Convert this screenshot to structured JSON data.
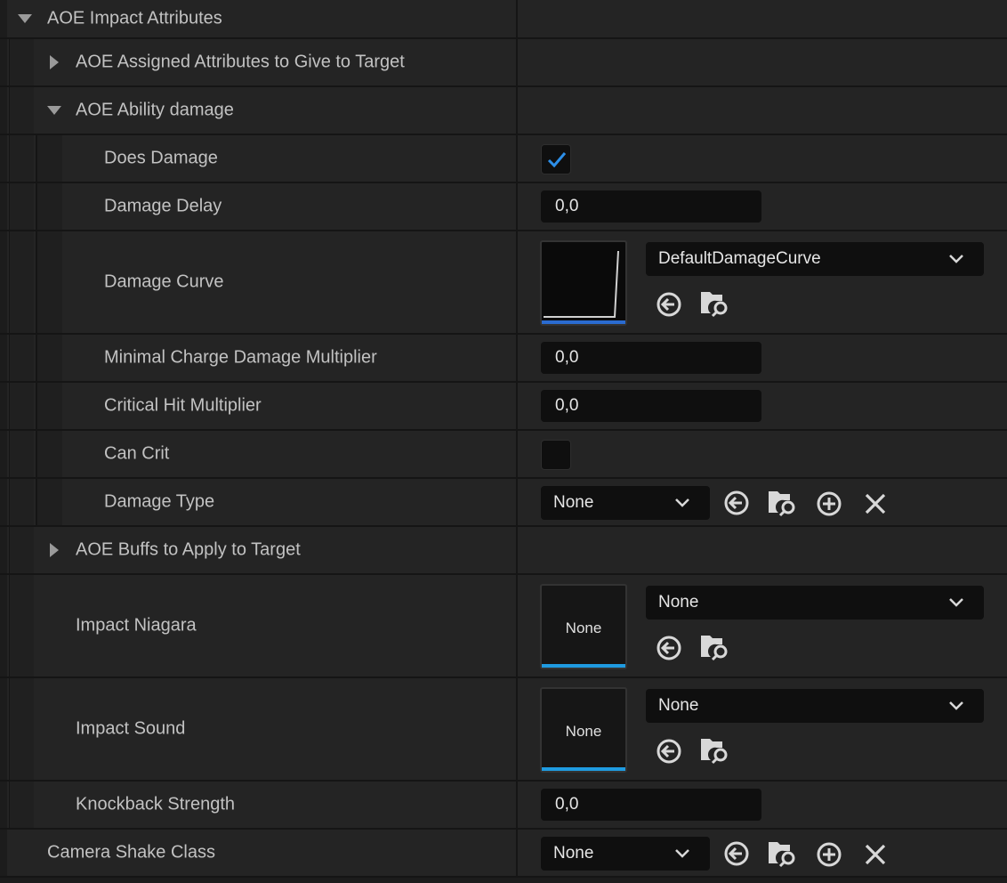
{
  "colors": {
    "accent_blue": "#1f9be0",
    "curve_bar": "#2a6bd0",
    "check_blue": "#2d8fe8",
    "background": "#242424",
    "field": "#0f0f0f"
  },
  "icons": {
    "expanded": "triangle-down-icon",
    "collapsed": "triangle-right-icon",
    "use_selected": "arrow-left-circle-icon",
    "browse": "folder-search-icon",
    "add": "plus-circle-icon",
    "clear": "x-icon",
    "dropdown": "chevron-down-icon",
    "check": "checkmark-icon"
  },
  "rows": {
    "aoe_impact": {
      "label": "AOE Impact Attributes"
    },
    "assigned_attrs": {
      "label": "AOE Assigned Attributes to Give to Target"
    },
    "ability_damage": {
      "label": "AOE Ability damage"
    },
    "does_damage": {
      "label": "Does Damage",
      "checked": true
    },
    "damage_delay": {
      "label": "Damage Delay",
      "value": "0,0"
    },
    "damage_curve": {
      "label": "Damage Curve",
      "asset": "DefaultDamageCurve"
    },
    "min_charge": {
      "label": "Minimal Charge Damage Multiplier",
      "value": "0,0"
    },
    "crit_mult": {
      "label": "Critical Hit Multiplier",
      "value": "0,0"
    },
    "can_crit": {
      "label": "Can Crit",
      "checked": false
    },
    "damage_type": {
      "label": "Damage Type",
      "value": "None"
    },
    "buffs": {
      "label": "AOE Buffs to Apply to Target"
    },
    "impact_niagara": {
      "label": "Impact Niagara",
      "asset": "None",
      "thumb": "None"
    },
    "impact_sound": {
      "label": "Impact Sound",
      "asset": "None",
      "thumb": "None"
    },
    "knockback": {
      "label": "Knockback Strength",
      "value": "0,0"
    },
    "camera_shake": {
      "label": "Camera Shake Class",
      "value": "None"
    }
  }
}
